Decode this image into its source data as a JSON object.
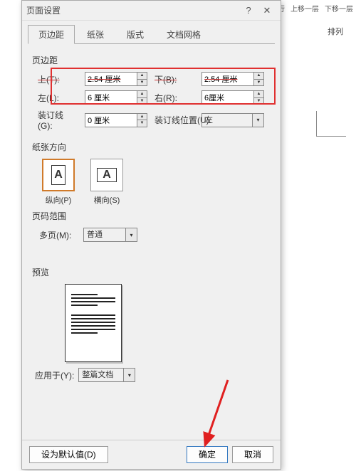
{
  "ribbon": {
    "t1": "行",
    "t2": "上移一层",
    "t3": "下移一层",
    "align": "排列"
  },
  "dialog": {
    "title": "页面设置",
    "tabs": {
      "margins": "页边距",
      "paper": "纸张",
      "layout": "版式",
      "grid": "文档网格"
    },
    "section_margins": "页边距",
    "labels": {
      "top": "上(T):",
      "bottom": "下(B):",
      "left": "左(L):",
      "right": "右(R):",
      "gutter": "装订线(G):",
      "gutter_pos": "装订线位置(U):"
    },
    "values": {
      "top": "2.54 厘米",
      "bottom": "2.54 厘米",
      "left": "6 厘米",
      "right": "6厘米",
      "gutter": "0 厘米",
      "gutter_pos": "左"
    },
    "section_orient": "纸张方向",
    "orient": {
      "portrait": "纵向(P)",
      "landscape": "横向(S)",
      "glyph": "A"
    },
    "section_range": "页码范围",
    "multipage": {
      "label": "多页(M):",
      "value": "普通"
    },
    "section_preview": "预览",
    "apply_to": {
      "label": "应用于(Y):",
      "value": "整篇文档"
    },
    "footer": {
      "default": "设为默认值(D)",
      "ok": "确定",
      "cancel": "取消"
    }
  }
}
